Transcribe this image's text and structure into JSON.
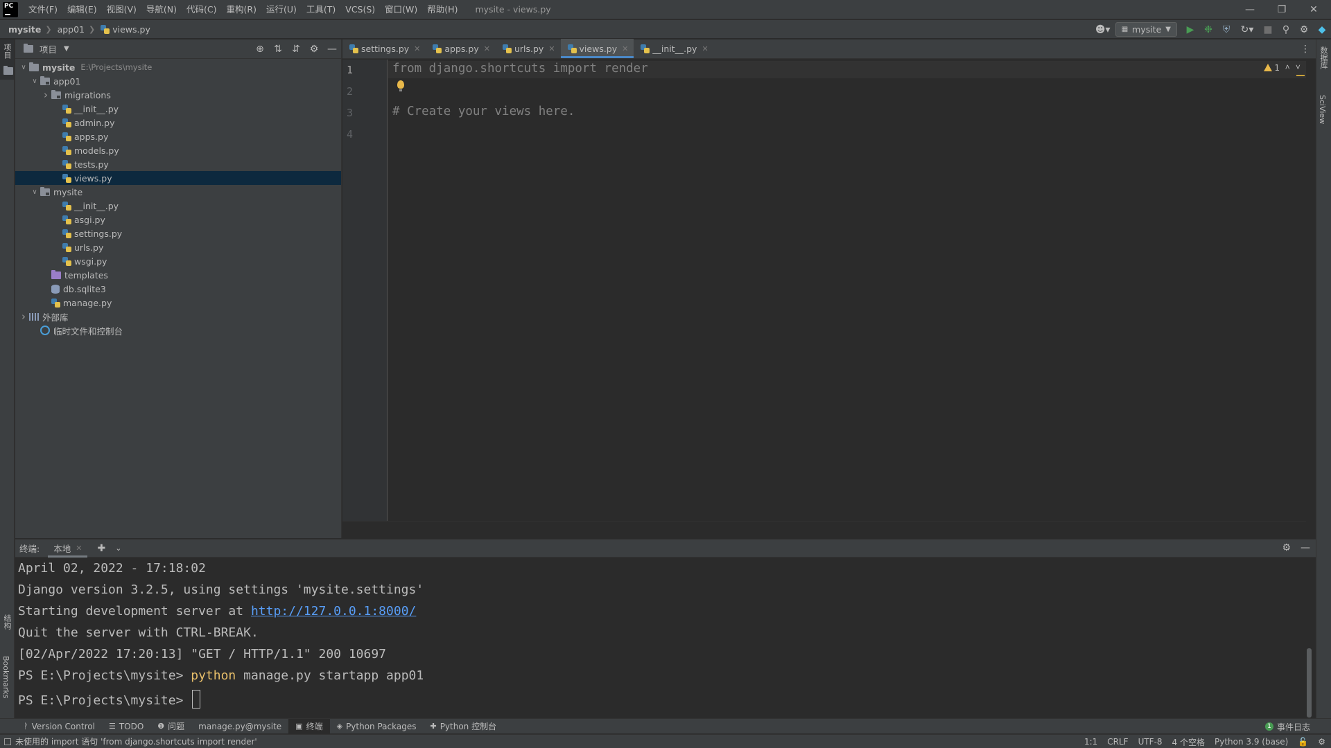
{
  "app": {
    "logo_text": "PC",
    "window_title": "mysite - views.py",
    "menu": [
      "文件(F)",
      "编辑(E)",
      "视图(V)",
      "导航(N)",
      "代码(C)",
      "重构(R)",
      "运行(U)",
      "工具(T)",
      "VCS(S)",
      "窗口(W)",
      "帮助(H)"
    ]
  },
  "breadcrumb": [
    "mysite",
    "app01",
    "views.py"
  ],
  "toolbar": {
    "run_config": "mysite"
  },
  "left_stripe": {
    "project": "项目",
    "structure": "结构",
    "bookmarks": "Bookmarks"
  },
  "right_stripe": {
    "database": "数据库",
    "sciview": "SciView"
  },
  "project_panel": {
    "title": "项目",
    "tree": [
      {
        "label": "mysite",
        "path": "E:\\Projects\\mysite",
        "depth": 0,
        "arrow": "v",
        "icon": "folder",
        "bold": true
      },
      {
        "label": "app01",
        "depth": 1,
        "arrow": "v",
        "icon": "folder-mod"
      },
      {
        "label": "migrations",
        "depth": 2,
        "arrow": ">",
        "icon": "folder-mod"
      },
      {
        "label": "__init__.py",
        "depth": 3,
        "arrow": "",
        "icon": "py"
      },
      {
        "label": "admin.py",
        "depth": 3,
        "arrow": "",
        "icon": "py"
      },
      {
        "label": "apps.py",
        "depth": 3,
        "arrow": "",
        "icon": "py"
      },
      {
        "label": "models.py",
        "depth": 3,
        "arrow": "",
        "icon": "py"
      },
      {
        "label": "tests.py",
        "depth": 3,
        "arrow": "",
        "icon": "py"
      },
      {
        "label": "views.py",
        "depth": 3,
        "arrow": "",
        "icon": "py",
        "selected": true
      },
      {
        "label": "mysite",
        "depth": 1,
        "arrow": "v",
        "icon": "folder-mod"
      },
      {
        "label": "__init__.py",
        "depth": 3,
        "arrow": "",
        "icon": "py"
      },
      {
        "label": "asgi.py",
        "depth": 3,
        "arrow": "",
        "icon": "py"
      },
      {
        "label": "settings.py",
        "depth": 3,
        "arrow": "",
        "icon": "py"
      },
      {
        "label": "urls.py",
        "depth": 3,
        "arrow": "",
        "icon": "py"
      },
      {
        "label": "wsgi.py",
        "depth": 3,
        "arrow": "",
        "icon": "py"
      },
      {
        "label": "templates",
        "depth": 2,
        "arrow": "",
        "icon": "folder-purple"
      },
      {
        "label": "db.sqlite3",
        "depth": 2,
        "arrow": "",
        "icon": "db"
      },
      {
        "label": "manage.py",
        "depth": 2,
        "arrow": "",
        "icon": "py"
      },
      {
        "label": "外部库",
        "depth": 0,
        "arrow": ">",
        "icon": "lib"
      },
      {
        "label": "临时文件和控制台",
        "depth": 1,
        "arrow": "",
        "icon": "scratch"
      }
    ]
  },
  "editor": {
    "tabs": [
      {
        "label": "settings.py",
        "active": false
      },
      {
        "label": "apps.py",
        "active": false
      },
      {
        "label": "urls.py",
        "active": false
      },
      {
        "label": "views.py",
        "active": true
      },
      {
        "label": "__init__.py",
        "active": false
      }
    ],
    "line_numbers": [
      "1",
      "2",
      "3",
      "4"
    ],
    "lines": [
      "from django.shortcuts import render",
      "",
      "# Create your views here.",
      ""
    ],
    "warning_count": "1"
  },
  "terminal": {
    "title": "终端:",
    "tab_label": "本地",
    "lines": [
      "April 02, 2022 - 17:18:02",
      "Django version 3.2.5, using settings 'mysite.settings'",
      "Starting development server at ",
      "Quit the server with CTRL-BREAK.",
      "[02/Apr/2022 17:20:13] \"GET / HTTP/1.1\" 200 10697",
      "PS E:\\Projects\\mysite> ",
      "PS E:\\Projects\\mysite> "
    ],
    "link": "http://127.0.0.1:8000/",
    "cmd_keyword": "python",
    "cmd_rest": " manage.py startapp app01"
  },
  "tool_windows": [
    {
      "glyph": "ᚹ",
      "label": "Version Control"
    },
    {
      "glyph": "☰",
      "label": "TODO"
    },
    {
      "glyph": "❶",
      "label": "问题"
    },
    {
      "glyph": "",
      "label": "manage.py@mysite"
    },
    {
      "glyph": "▣",
      "label": "终端",
      "active": true
    },
    {
      "glyph": "◈",
      "label": "Python Packages"
    },
    {
      "glyph": "✚",
      "label": "Python 控制台"
    }
  ],
  "event_log": {
    "count": "1",
    "label": "事件日志"
  },
  "status": {
    "message": "未使用的 import 语句 'from django.shortcuts import render'",
    "position": "1:1",
    "line_sep": "CRLF",
    "encoding": "UTF-8",
    "indent": "4 个空格",
    "interpreter": "Python 3.9 (base)"
  },
  "colors": {
    "accent": "#4a88c7",
    "selection": "#0d293e",
    "link": "#589df6",
    "warning": "#e8b84a"
  }
}
